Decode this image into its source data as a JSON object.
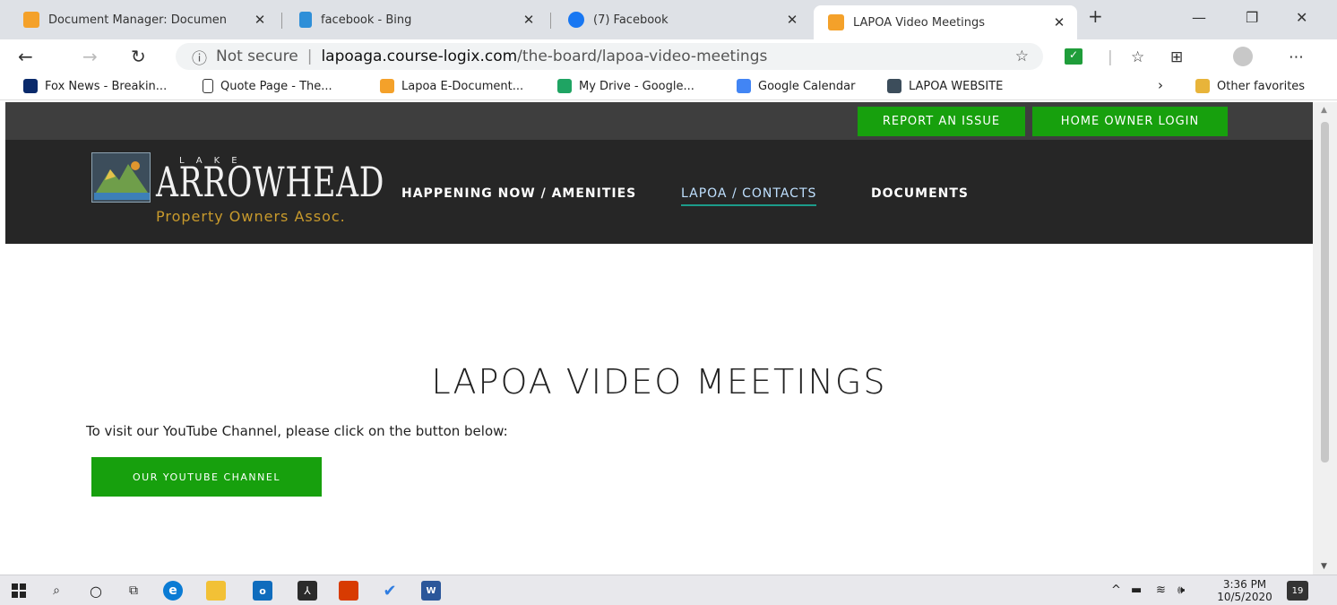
{
  "tabs": [
    {
      "title": "Document Manager: Documen",
      "favicon": "joomla-icon",
      "favcolor": "#f4a12a"
    },
    {
      "title": "facebook - Bing",
      "favicon": "bing-icon",
      "favcolor": "#2f8fd8"
    },
    {
      "title": "(7) Facebook",
      "favicon": "facebook-icon",
      "favcolor": "#1877f2"
    },
    {
      "title": "LAPOA Video Meetings",
      "favicon": "joomla-icon",
      "favcolor": "#f4a12a"
    }
  ],
  "address": {
    "secure": "Not secure",
    "host": "lapoaga.course-logix.com",
    "path": "/the-board/lapoa-video-meetings"
  },
  "bookmarks": [
    {
      "label": "Fox News - Breakin...",
      "icon": "fox-news-icon",
      "color": "#0a2a6b"
    },
    {
      "label": "Quote Page - The...",
      "icon": "page-icon",
      "color": "#ffffff"
    },
    {
      "label": "Lapoa E-Document...",
      "icon": "joomla-icon",
      "color": "#f4a12a"
    },
    {
      "label": "My Drive - Google...",
      "icon": "google-drive-icon",
      "color": "#1fa463"
    },
    {
      "label": "Google Calendar",
      "icon": "google-calendar-icon",
      "color": "#4285f4"
    },
    {
      "label": "LAPOA WEBSITE",
      "icon": "lapoa-icon",
      "color": "#3c4d5b"
    }
  ],
  "other_favorites": "Other favorites",
  "site": {
    "report_issue": "REPORT AN ISSUE",
    "home_owner_login": "HOME OWNER LOGIN",
    "logo": {
      "lake": "LAKE",
      "arrowhead": "ARROWHEAD",
      "poa": "Property Owners Assoc."
    },
    "nav": [
      "HAPPENING NOW / AMENITIES",
      "LAPOA / CONTACTS",
      "DOCUMENTS"
    ],
    "title": "LAPOA VIDEO MEETINGS",
    "intro": "To visit our YouTube Channel, please click on the button below:",
    "youtube_button": "OUR YOUTUBE CHANNEL",
    "accent": "#17a00d"
  },
  "taskbar": {
    "time": "3:36 PM",
    "date": "10/5/2020",
    "notifications": "19"
  }
}
